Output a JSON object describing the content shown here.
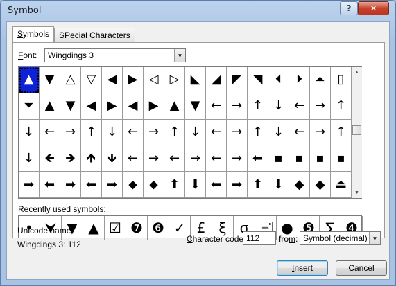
{
  "window": {
    "title": "Symbol"
  },
  "titlebar": {
    "help_glyph": "?",
    "close_glyph": "✕"
  },
  "tabs": [
    {
      "accel": "S",
      "rest": "ymbols"
    },
    {
      "accel": "P",
      "rest": "ecial Characters",
      "pre": "S"
    }
  ],
  "font": {
    "label_accel": "F",
    "label_rest": "ont:",
    "value": "Wingdings 3"
  },
  "grid": {
    "rows": [
      [
        "▲",
        "▼",
        "△",
        "▽",
        "◀",
        "▶",
        "◁",
        "▷",
        "◣",
        "◢",
        "◤",
        "◥",
        "⏴",
        "⏵",
        "⏶",
        "▯"
      ],
      [
        "⏷",
        "▲",
        "▼",
        "◀",
        "▶",
        "◀",
        "▶",
        "▲",
        "▼",
        "←",
        "→",
        "↑",
        "↓",
        "←",
        "→",
        "↑"
      ],
      [
        "↓",
        "←",
        "→",
        "↑",
        "↓",
        "←",
        "→",
        "↑",
        "↓",
        "←",
        "→",
        "↑",
        "↓",
        "←",
        "→",
        "↑"
      ],
      [
        "↓",
        "🡸",
        "🡺",
        "🡹",
        "🡻",
        "←",
        "→",
        "←",
        "→",
        "←",
        "→",
        "⬅",
        "▪",
        "▪",
        "▪",
        "▪"
      ],
      [
        "➡",
        "⬅",
        "➡",
        "⬅",
        "➡",
        "⬥",
        "⬥",
        "⬆",
        "⬇",
        "⬅",
        "➡",
        "⬆",
        "⬇",
        "◆",
        "◆",
        "⏏"
      ]
    ],
    "selected_index": 0
  },
  "recent": {
    "label_accel": "R",
    "label_rest": "ecently used symbols:",
    "symbols": [
      "•",
      "⮟",
      "▼",
      "▲",
      "☑",
      "❼",
      "❻",
      "✓",
      "£",
      "ξ",
      "σ",
      "🖃",
      "●",
      "❺",
      "∑",
      "❹"
    ]
  },
  "unicode": {
    "label": "Unicode name:",
    "value": "Wingdings 3: 112"
  },
  "char_code": {
    "label_accel": "C",
    "label_rest": "haracter code:",
    "value": "112"
  },
  "from": {
    "label_pre": "fro",
    "label_accel": "m",
    "label_post": ":",
    "value": "Symbol (decimal)"
  },
  "buttons": {
    "insert_accel": "I",
    "insert_rest": "nsert",
    "cancel": "Cancel"
  }
}
